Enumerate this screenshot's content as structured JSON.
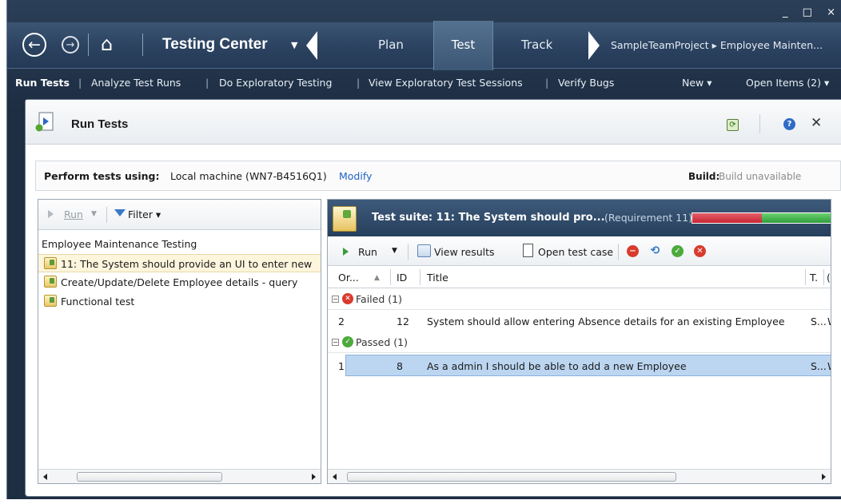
{
  "window": {
    "controls": "_ □ ×"
  },
  "nav": {
    "app_name": "Testing Center",
    "tabs": [
      {
        "label": "Plan"
      },
      {
        "label": "Test"
      },
      {
        "label": "Track"
      }
    ],
    "project_path": "SampleTeamProject ▸ Employee Mainten..."
  },
  "subnav": {
    "items": [
      {
        "label": "Run Tests"
      },
      {
        "label": "Analyze Test Runs"
      },
      {
        "label": "Do Exploratory Testing"
      },
      {
        "label": "View Exploratory Test Sessions"
      },
      {
        "label": "Verify Bugs"
      }
    ],
    "new_label": "New ▾",
    "open_items_label": "Open Items (2) ▾"
  },
  "page": {
    "title": "Run Tests"
  },
  "perform": {
    "label": "Perform tests using:",
    "value": "Local machine (WN7-B4516Q1)",
    "modify": "Modify",
    "build_label": "Build:",
    "build_value": "Build unavailable"
  },
  "left_toolbar": {
    "run_label": "Run",
    "filter_label": "Filter ▾"
  },
  "tree": {
    "root": "Employee Maintenance Testing",
    "items": [
      {
        "label": "11: The System should provide an UI to enter new"
      },
      {
        "label": "Create/Update/Delete Employee details  -  query"
      },
      {
        "label": "Functional test"
      }
    ]
  },
  "suite": {
    "title": "Test suite:  11: The System should pro...",
    "requirement": "(Requirement 11)",
    "progress": {
      "failed_fraction": 0.5,
      "passed_fraction": 0.5,
      "failed_color": "#d0343f",
      "passed_color": "#3fb04a"
    }
  },
  "right_toolbar": {
    "run_label": "Run",
    "view_results_label": "View results",
    "open_test_case_label": "Open test case"
  },
  "grid": {
    "columns": [
      {
        "label": "Or..."
      },
      {
        "label": "ID"
      },
      {
        "label": "Title"
      },
      {
        "label": "T."
      },
      {
        "label": "("
      }
    ],
    "groups": [
      {
        "label": "Failed (1)",
        "rows": [
          {
            "order": "2",
            "id": "12",
            "title": "System should allow entering Absence details for an existing Employee",
            "t": "S...",
            "c": "W"
          }
        ]
      },
      {
        "label": "Passed (1)",
        "rows": [
          {
            "order": "1",
            "id": "8",
            "title": "As a admin I should be able to add a new Employee",
            "t": "S...",
            "c": "W"
          }
        ]
      }
    ]
  }
}
